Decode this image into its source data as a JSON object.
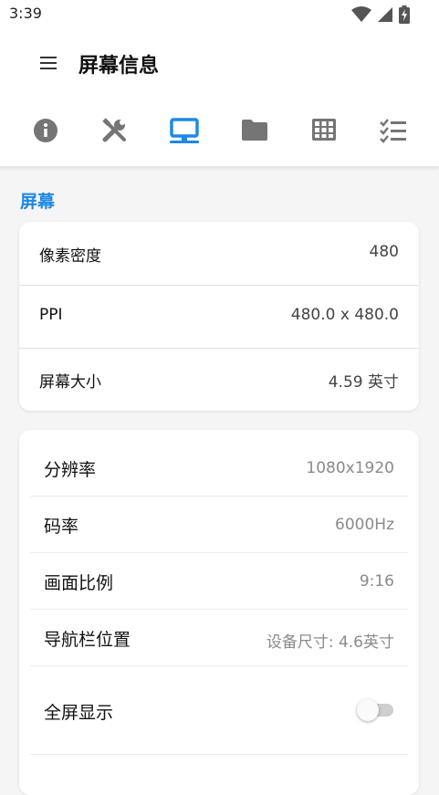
{
  "status_bar": {
    "time": "3:39",
    "icons": [
      "wifi-icon",
      "signal-icon",
      "battery-charging-icon"
    ]
  },
  "header": {
    "title": "屏幕信息",
    "menu_icon": "menu-icon"
  },
  "tabs": [
    {
      "name": "info-icon",
      "active": false
    },
    {
      "name": "tools-icon",
      "active": false
    },
    {
      "name": "monitor-icon",
      "active": true
    },
    {
      "name": "folder-icon",
      "active": false
    },
    {
      "name": "grid-icon",
      "active": false
    },
    {
      "name": "checklist-icon",
      "active": false
    }
  ],
  "section": {
    "title": "屏幕"
  },
  "screen_info": [
    {
      "label": "像素密度",
      "value": "480"
    },
    {
      "label": "PPI",
      "value": "480.0 x 480.0"
    },
    {
      "label": "屏幕大小",
      "value": "4.59 英寸"
    }
  ],
  "settings": [
    {
      "label": "分辨率",
      "value": "1080x1920"
    },
    {
      "label": "码率",
      "value": "6000Hz"
    },
    {
      "label": "画面比例",
      "value": "9:16"
    },
    {
      "label": "导航栏位置",
      "value": "设备尺寸: 4.6英寸"
    },
    {
      "label": "全屏显示",
      "toggle_on": false
    }
  ],
  "colors": {
    "accent": "#1e88e5",
    "icon_gray": "#757575",
    "background": "#f5f5f5"
  }
}
